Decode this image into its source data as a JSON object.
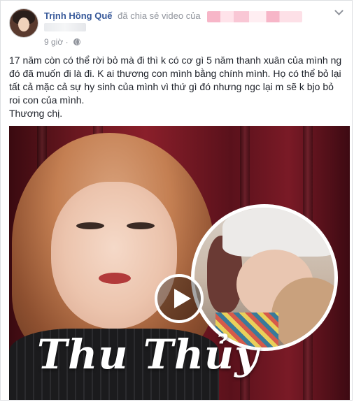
{
  "post": {
    "author": "Trịnh Hồng Quế",
    "action": "đã chia sẻ video của",
    "time": "9 giờ",
    "privacy_icon": "globe-icon",
    "menu_icon": "chevron-down-icon",
    "text_lines": [
      "17 năm còn có thể rời bỏ mà đi thì k có cơ gì 5 năm thanh xuân của mình ng đó đã muốn đi là đi. K ai thương con mình bằng chính mình. Họ có thể bỏ lại tất cả mặc cả sự hy sinh của mình vì thứ gì đó nhưng ngc lại m sẽ k bjo bỏ roi con của mình.",
      "Thương chị."
    ]
  },
  "video": {
    "title": "Thu Thủy",
    "play_icon": "play-icon"
  }
}
